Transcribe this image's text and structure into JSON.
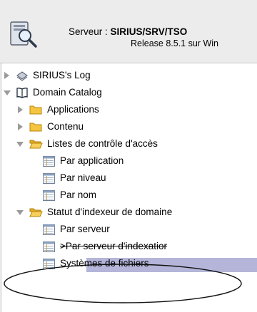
{
  "header": {
    "server_prefix": "Serveur : ",
    "server_name": "SIRIUS/SRV/TSO",
    "release": "Release 8.5.1 sur Win"
  },
  "tree": [
    {
      "label": "SIRIUS's Log",
      "icon": "log-icon",
      "twisty": "collapsed"
    },
    {
      "label": "Domain Catalog",
      "icon": "book-icon",
      "twisty": "expanded"
    },
    {
      "label": "Applications",
      "icon": "folder-icon",
      "twisty": "collapsed"
    },
    {
      "label": "Contenu",
      "icon": "folder-icon",
      "twisty": "collapsed"
    },
    {
      "label": "Listes de contrôle d'accès",
      "icon": "folder-open-icon",
      "twisty": "expanded"
    },
    {
      "label": "Par application",
      "icon": "view-icon",
      "twisty": "none"
    },
    {
      "label": "Par niveau",
      "icon": "view-icon",
      "twisty": "none"
    },
    {
      "label": "Par nom",
      "icon": "view-icon",
      "twisty": "none"
    },
    {
      "label": "Statut d'indexeur de domaine",
      "icon": "folder-open-icon",
      "twisty": "expanded"
    },
    {
      "label": "Par serveur",
      "icon": "view-icon",
      "twisty": "none"
    },
    {
      "label": ">Par serveur d'indexatior",
      "icon": "view-icon",
      "twisty": "none",
      "selected": true
    },
    {
      "label": "Systèmes de fichiers",
      "icon": "view-icon",
      "twisty": "none"
    }
  ],
  "colors": {
    "selection": "#b4b5d8",
    "header_bg": "#ececec",
    "folder": "#f5c542",
    "twisty": "#9a9a9a"
  }
}
